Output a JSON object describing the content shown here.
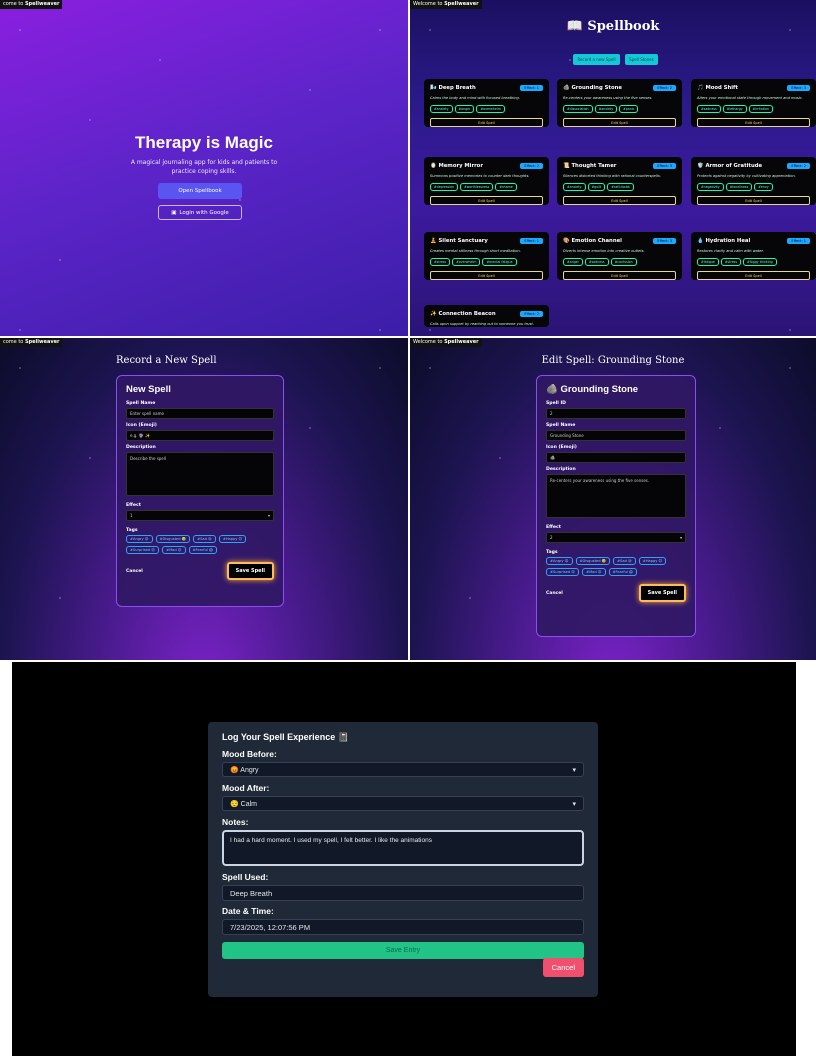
{
  "welcome": {
    "prefix": "Welcome to ",
    "brand": "Spellweaver",
    "prefix_cut": "come to "
  },
  "landing": {
    "title": "Therapy is Magic",
    "subtitle": "A magical journaling app for kids and patients to practice coping skills.",
    "open_label": "Open Spellbook",
    "google_label": "Login with Google",
    "google_icon": "calendar-icon"
  },
  "spellbook": {
    "title": "📖 Spellbook",
    "record_label": "Record a new Spell",
    "stones_label": "Spell Stones",
    "edit_label": "Edit Spell",
    "cards": [
      {
        "icon": "🌬️",
        "name": "Deep Breath",
        "effect": "Effect: 1",
        "desc": "Calms the body and mind with focused breathing.",
        "tags": [
          "#anxiety",
          "#anger",
          "#overwhelm"
        ]
      },
      {
        "icon": "🪨",
        "name": "Grounding Stone",
        "effect": "Effect: 2",
        "desc": "Re-centers your awareness using the five senses.",
        "tags": [
          "#dissociation",
          "#anxiety",
          "#panic"
        ]
      },
      {
        "icon": "🎵",
        "name": "Mood Shift",
        "effect": "Effect: 3",
        "desc": "Alters your emotional state through movement and music.",
        "tags": [
          "#sadness",
          "#lethargy",
          "#irritation"
        ]
      },
      {
        "icon": "🪞",
        "name": "Memory Mirror",
        "effect": "Effect: 2",
        "desc": "Summons positive memories to counter dark thoughts.",
        "tags": [
          "#depression",
          "#worthlessness",
          "#shame"
        ]
      },
      {
        "icon": "📜",
        "name": "Thought Tamer",
        "effect": "Effect: 3",
        "desc": "Silences distorted thinking with rational counterspells.",
        "tags": [
          "#anxiety",
          "#guilt",
          "#self-doubt"
        ]
      },
      {
        "icon": "🛡️",
        "name": "Armor of Gratitude",
        "effect": "Effect: 2",
        "desc": "Protects against negativity by cultivating appreciation.",
        "tags": [
          "#negativity",
          "#loneliness",
          "#envy"
        ]
      },
      {
        "icon": "🧘",
        "name": "Silent Sanctuary",
        "effect": "Effect: 1",
        "desc": "Creates mental stillness through short meditation.",
        "tags": [
          "#stress",
          "#overwhelm",
          "#mental fatigue"
        ]
      },
      {
        "icon": "🎨",
        "name": "Emotion Channel",
        "effect": "Effect: 3",
        "desc": "Diverts intense emotion into creative outlets.",
        "tags": [
          "#anger",
          "#sadness",
          "#confusion"
        ]
      },
      {
        "icon": "💧",
        "name": "Hydration Heal",
        "effect": "Effect: 1",
        "desc": "Restores clarity and calm with water.",
        "tags": [
          "#fatigue",
          "#stress",
          "#foggy thinking"
        ]
      },
      {
        "icon": "✨",
        "name": "Connection Beacon",
        "effect": "Effect: 2",
        "desc": "Calls upon support by reaching out to someone you trust.",
        "tags": []
      }
    ]
  },
  "new_spell": {
    "heading": "Record a New Spell",
    "title": "New Spell",
    "name_label": "Spell Name",
    "name_placeholder": "Enter spell name",
    "icon_label": "Icon (Emoji)",
    "icon_value": "e.g. 🔮 ✨",
    "desc_label": "Description",
    "desc_placeholder": "Describe the spell",
    "effect_label": "Effect",
    "effect_value": "1",
    "tags_label": "Tags",
    "cancel": "Cancel",
    "save": "Save Spell"
  },
  "tags": [
    "#Angry 😡",
    "#Disgusted 🤢",
    "#Sad 😢",
    "#Happy 😊",
    "#Surprised 😲",
    "#Mad 😠",
    "#Fearful 😱"
  ],
  "edit_spell": {
    "heading": "Edit Spell: Grounding Stone",
    "title": "🪨 Grounding Stone",
    "id_label": "Spell ID",
    "id_value": "2",
    "name_label": "Spell Name",
    "name_value": "Grounding Stone",
    "icon_label": "Icon (Emoji)",
    "icon_value": "🪨",
    "desc_label": "Description",
    "desc_value": "Re-centers your awareness using the five senses.",
    "effect_label": "Effect",
    "effect_value": "2",
    "tags_label": "Tags",
    "cancel": "Cancel",
    "save": "Save Spell"
  },
  "log": {
    "title": "Log Your Spell Experience 📓",
    "before_label": "Mood Before:",
    "before_value": "😡 Angry",
    "after_label": "Mood After:",
    "after_value": "😌 Calm",
    "notes_label": "Notes:",
    "notes_value": "I had a hard moment. I used my spell, I felt better. I like the animations",
    "spell_label": "Spell Used:",
    "spell_value": "Deep Breath",
    "date_label": "Date & Time:",
    "date_value": "7/23/2025, 12:07:56 PM",
    "save": "Save Entry",
    "cancel": "Cancel"
  }
}
